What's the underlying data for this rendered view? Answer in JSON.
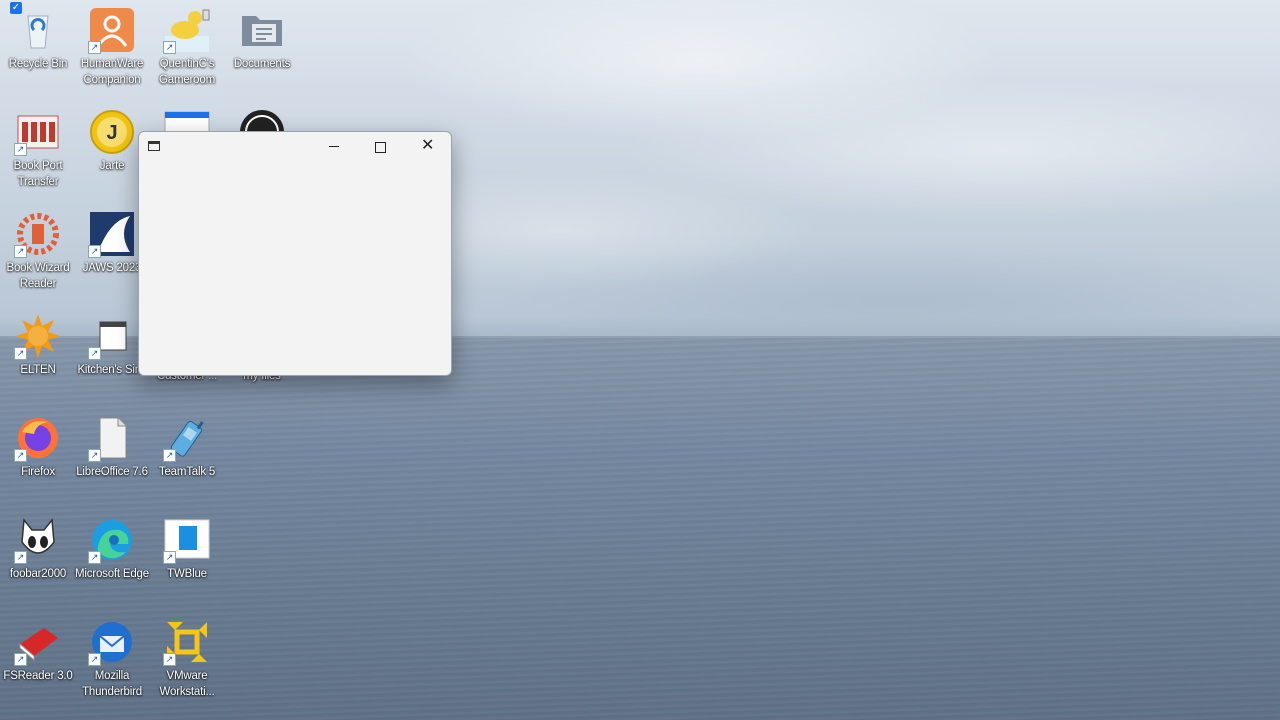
{
  "desktop": {
    "icons": [
      {
        "label": "Recycle Bin"
      },
      {
        "label": "HumanWare Companion"
      },
      {
        "label": "QuentinC's Gameroom"
      },
      {
        "label": "Documents"
      },
      {
        "label": "Book Port Transfer"
      },
      {
        "label": "Jarte"
      },
      {
        "label": "Book Wizard Reader"
      },
      {
        "label": "JAWS 2023"
      },
      {
        "label": "ELTEN"
      },
      {
        "label": "Kitchen's Sink"
      },
      {
        "label": "Customer ..."
      },
      {
        "label": "my files"
      },
      {
        "label": "Firefox"
      },
      {
        "label": "LibreOffice 7.6"
      },
      {
        "label": "TeamTalk 5"
      },
      {
        "label": "foobar2000"
      },
      {
        "label": "Microsoft Edge"
      },
      {
        "label": "TWBlue"
      },
      {
        "label": "FSReader 3.0"
      },
      {
        "label": "Mozilla Thunderbird"
      },
      {
        "label": "VMware Workstati..."
      }
    ]
  },
  "window": {
    "title": "",
    "minimize_glyph": "—",
    "close_glyph": "✕"
  },
  "icons_meta": {
    "shortcut_arrow": "↗",
    "check": "✓"
  }
}
